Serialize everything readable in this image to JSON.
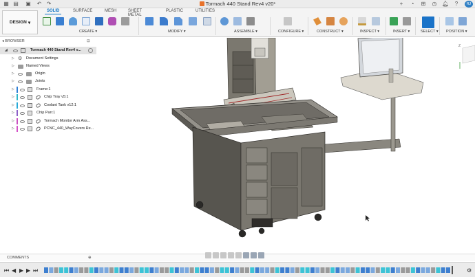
{
  "window": {
    "title": "Tormach 440 Stand Rev4 v20*"
  },
  "workspace": {
    "label": "DESIGN"
  },
  "tabs": [
    "SOLID",
    "SURFACE",
    "MESH",
    "SHEET METAL",
    "PLASTIC",
    "UTILITIES"
  ],
  "active_tab": "SOLID",
  "groups": {
    "create": "CREATE",
    "modify": "MODIFY",
    "assemble": "ASSEMBLE",
    "configure": "CONFIGURE",
    "construct": "CONSTRUCT",
    "inspect": "INSPECT",
    "insert": "INSERT",
    "select": "SELECT",
    "position": "POSITION"
  },
  "browser": {
    "title": "BROWSER",
    "root": "Tormach 440 Stand Rev4 v...",
    "items": [
      "Document Settings",
      "Named Views",
      "Origin",
      "Joints",
      "Frame:1",
      "Chip Tray v5:1",
      "Coolant Tank v12:1",
      "Chip Pan:1",
      "Tormach Monitor Arm Ass...",
      "PCNC_440_WayCovers Re..."
    ]
  },
  "comments": {
    "label": "COMMENTS"
  },
  "colors": {
    "accent": "#0a72c4",
    "timeline_blue": "#3d7fd0",
    "timeline_cyan": "#3cc3d6"
  }
}
